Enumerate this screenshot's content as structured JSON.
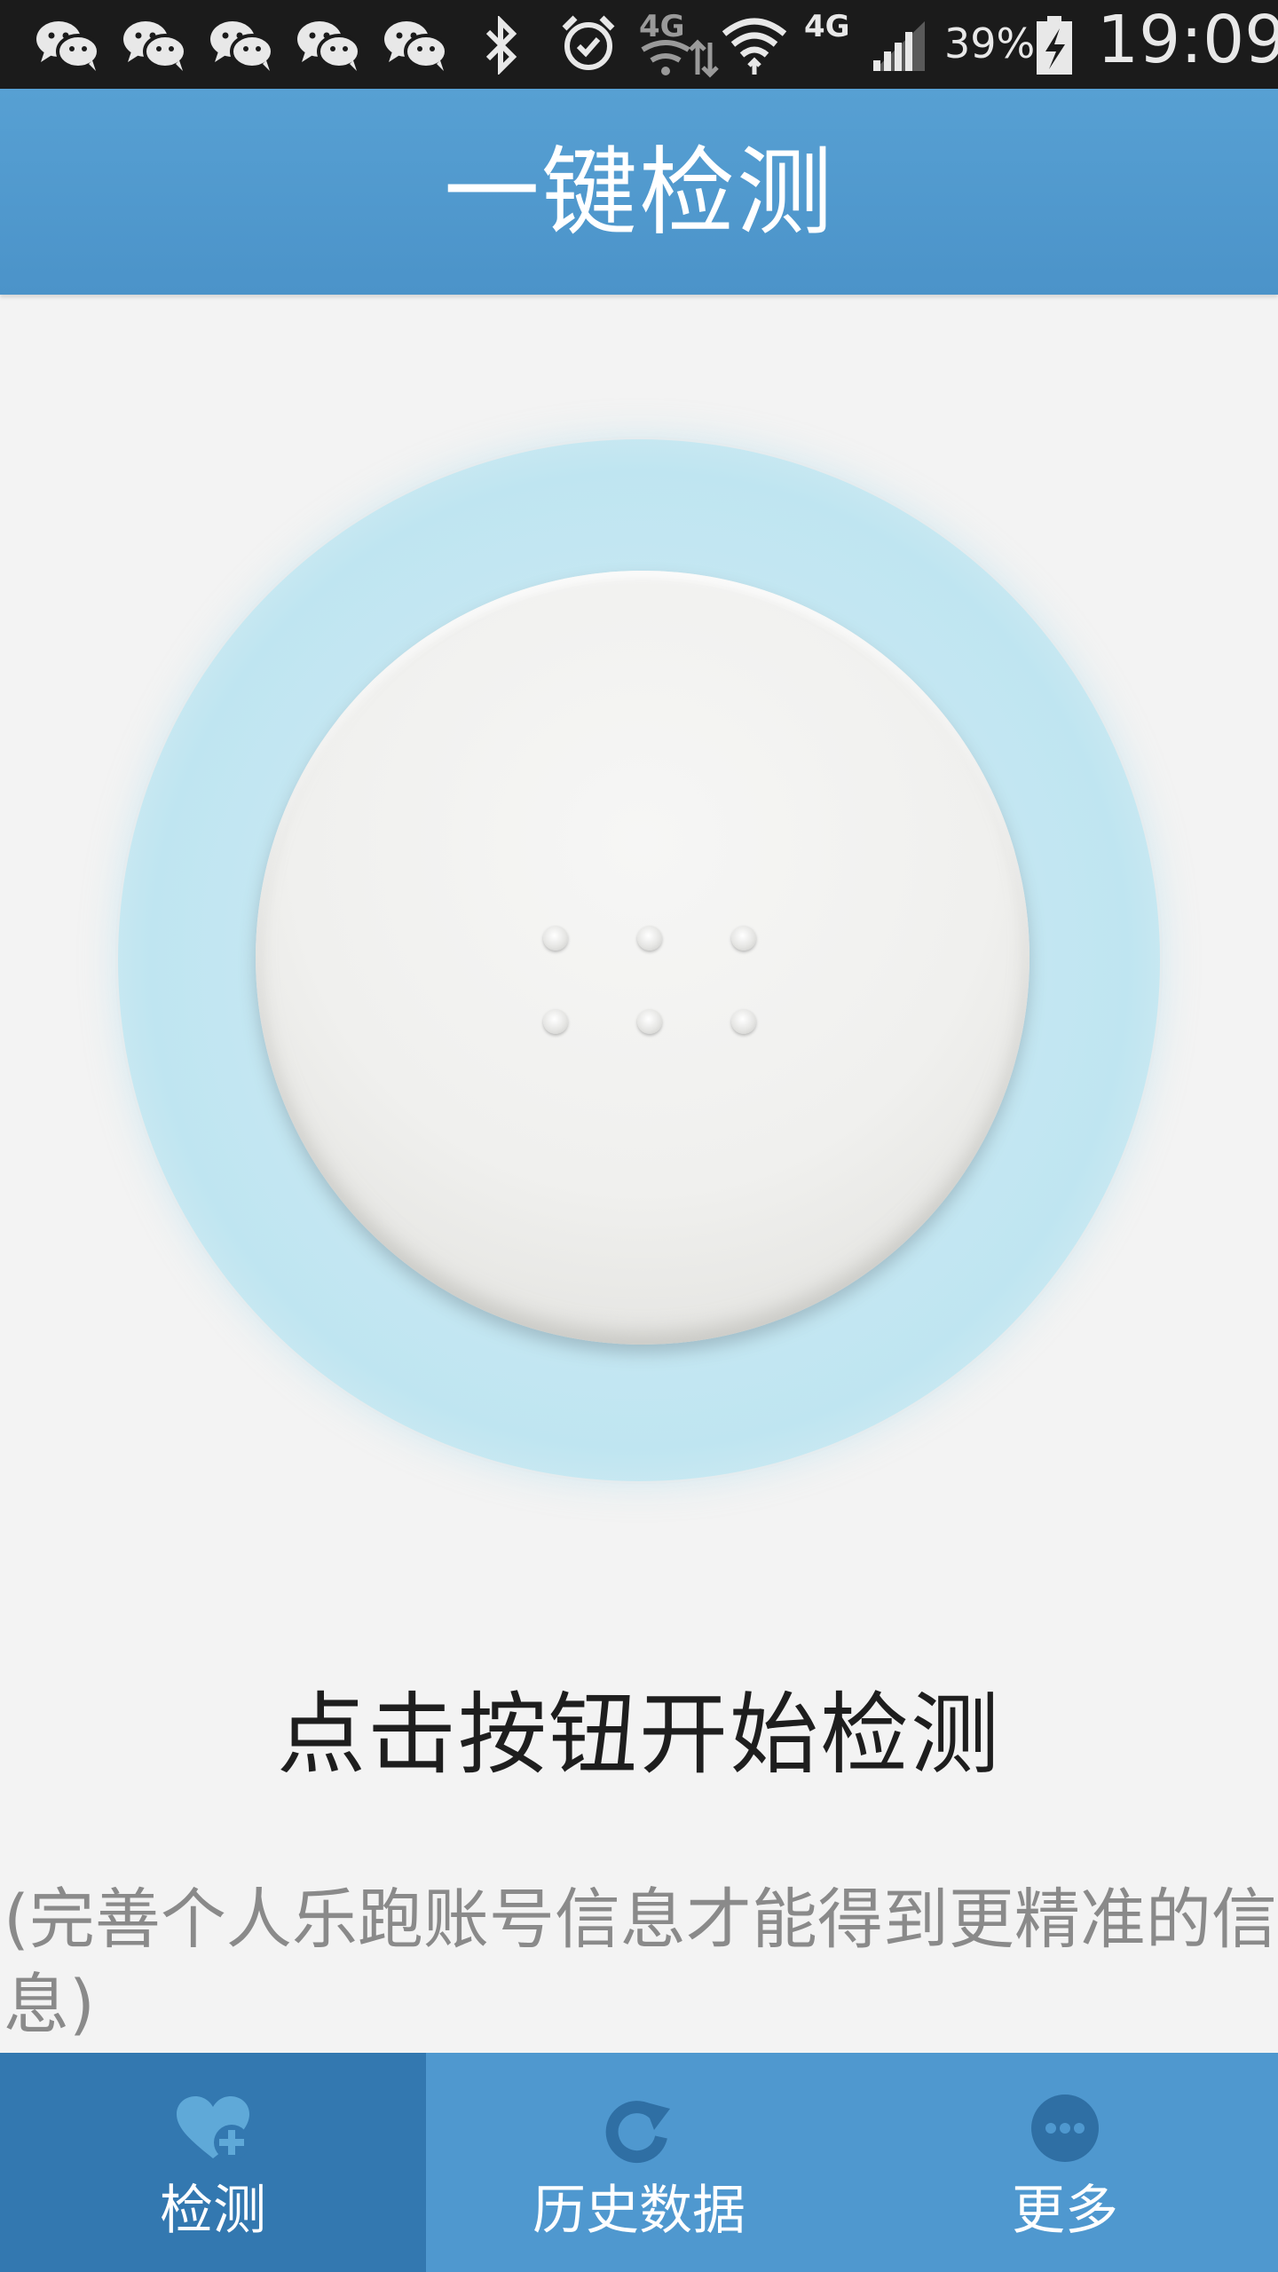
{
  "status_bar": {
    "network_1": "4G",
    "network_2": "4G",
    "battery": "39%",
    "time": "19:09",
    "icons": [
      "wechat-icon",
      "wechat-icon",
      "wechat-icon",
      "wechat-icon",
      "wechat-icon",
      "bluetooth-icon",
      "alarm-icon",
      "data-icon",
      "wifi-icon",
      "signal-icon",
      "battery-charging-icon"
    ]
  },
  "header": {
    "title": "一键检测"
  },
  "main": {
    "prompt": "点击按钮开始检测",
    "note": "(完善个人乐跑账号信息才能得到更精准的信息)"
  },
  "nav": {
    "items": [
      {
        "label": "检测",
        "icon": "heart-plus-icon",
        "active": true
      },
      {
        "label": "历史数据",
        "icon": "refresh-icon",
        "active": false
      },
      {
        "label": "更多",
        "icon": "more-icon",
        "active": false
      }
    ]
  },
  "colors": {
    "header": "#4f98cf",
    "nav_active": "#3378b0",
    "glow": "#bfe5f1"
  }
}
